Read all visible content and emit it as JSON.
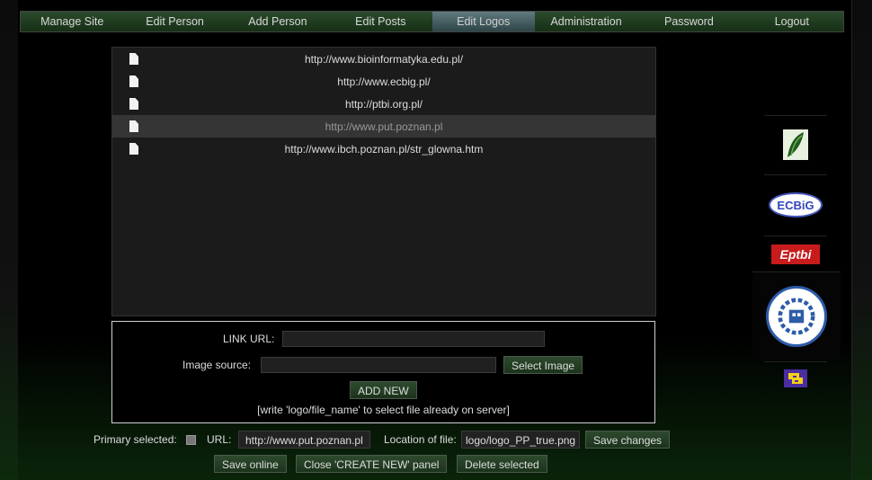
{
  "nav": {
    "items": [
      {
        "label": "Manage Site"
      },
      {
        "label": "Edit Person"
      },
      {
        "label": "Add Person"
      },
      {
        "label": "Edit Posts"
      },
      {
        "label": "Edit Logos"
      },
      {
        "label": "Administration"
      },
      {
        "label": "Password"
      },
      {
        "label": "Logout"
      }
    ],
    "active": "Edit Logos"
  },
  "logo_list": {
    "rows": [
      {
        "url": "http://www.bioinformatyka.edu.pl/"
      },
      {
        "url": "http://www.ecbig.pl/"
      },
      {
        "url": "http://ptbi.org.pl/"
      },
      {
        "url": "http://www.put.poznan.pl"
      },
      {
        "url": "http://www.ibch.poznan.pl/str_glowna.htm"
      }
    ],
    "selected_index": 3
  },
  "create_panel": {
    "link_url_label": "LINK URL:",
    "link_url_value": "",
    "image_source_label": "Image source:",
    "image_source_value": "",
    "select_image_label": "Select Image",
    "add_new_label": "ADD NEW",
    "hint": "[write 'logo/file_name' to select file already on server]"
  },
  "selected_item": {
    "primary_label": "Primary selected:",
    "url_label": "URL:",
    "url_value": "http://www.put.poznan.pl",
    "location_label": "Location of file:",
    "location_value": "logo/logo_PP_true.png",
    "save_changes_label": "Save changes",
    "save_online_label": "Save online",
    "close_panel_label": "Close 'CREATE NEW' panel",
    "delete_label": "Delete selected"
  },
  "sidebar_logos": [
    {
      "name": "bioinformatyka-logo"
    },
    {
      "name": "ecbig-logo",
      "text": "ECBiG"
    },
    {
      "name": "ptbi-logo",
      "text": "Εptbi"
    },
    {
      "name": "put-logo"
    },
    {
      "name": "ibch-logo"
    }
  ],
  "colors": {
    "nav_bg": "#163016",
    "nav_active": "#4a6468",
    "list_bg": "#1b1b1b",
    "selected_row": "#353535",
    "button_bg": "#244024"
  }
}
